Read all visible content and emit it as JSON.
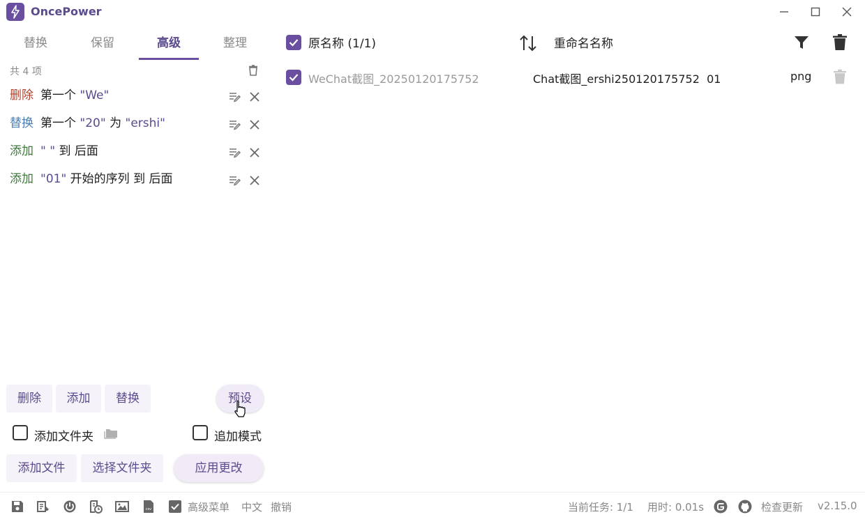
{
  "app": {
    "title": "OncePower"
  },
  "tabs": [
    {
      "label": "替换",
      "active": false
    },
    {
      "label": "保留",
      "active": false
    },
    {
      "label": "高级",
      "active": true
    },
    {
      "label": "整理",
      "active": false
    }
  ],
  "rules": {
    "count_label": "共 4 项",
    "items": [
      {
        "action": "删除",
        "text1": "第一个 ",
        "quote1": "\"We\"",
        "text2": "",
        "quote2": "",
        "text3": ""
      },
      {
        "action": "替换",
        "text1": "第一个 ",
        "quote1": "\"20\"",
        "text2": " 为 ",
        "quote2": "\"ershi\"",
        "text3": ""
      },
      {
        "action": "添加",
        "text1": "",
        "quote1": "\" \"",
        "text2": " 到 后面",
        "quote2": "",
        "text3": ""
      },
      {
        "action": "添加",
        "text1": "",
        "quote1": "\"01\"",
        "text2": " 开始的序列 到 后面",
        "quote2": "",
        "text3": ""
      }
    ]
  },
  "buttons": {
    "delete": "删除",
    "add": "添加",
    "replace": "替换",
    "preset": "预设",
    "add_file": "添加文件",
    "choose_folder": "选择文件夹",
    "apply": "应用更改"
  },
  "options": {
    "add_folder": {
      "label": "添加文件夹",
      "checked": false
    },
    "append_mode": {
      "label": "追加模式",
      "checked": false
    }
  },
  "file_list": {
    "col_original": "原名称 (1/1)",
    "col_new": "重命名名称",
    "rows": [
      {
        "checked": true,
        "original": "WeChat截图_20250120175752",
        "new_name": "Chat截图_ershi250120175752  01",
        "ext": "png"
      }
    ]
  },
  "statusbar": {
    "advanced_menu": "高级菜单",
    "advanced_menu_checked": true,
    "language": "中文",
    "undo": "撤销",
    "task": "当前任务: 1/1",
    "time": "用时: 0.01s",
    "check_update": "检查更新",
    "version": "v2.15.0"
  },
  "colors": {
    "accent": "#6a4fa0",
    "delete_action": "#b0432f",
    "replace_action": "#4a7fb5",
    "add_action": "#3f7a3a"
  }
}
